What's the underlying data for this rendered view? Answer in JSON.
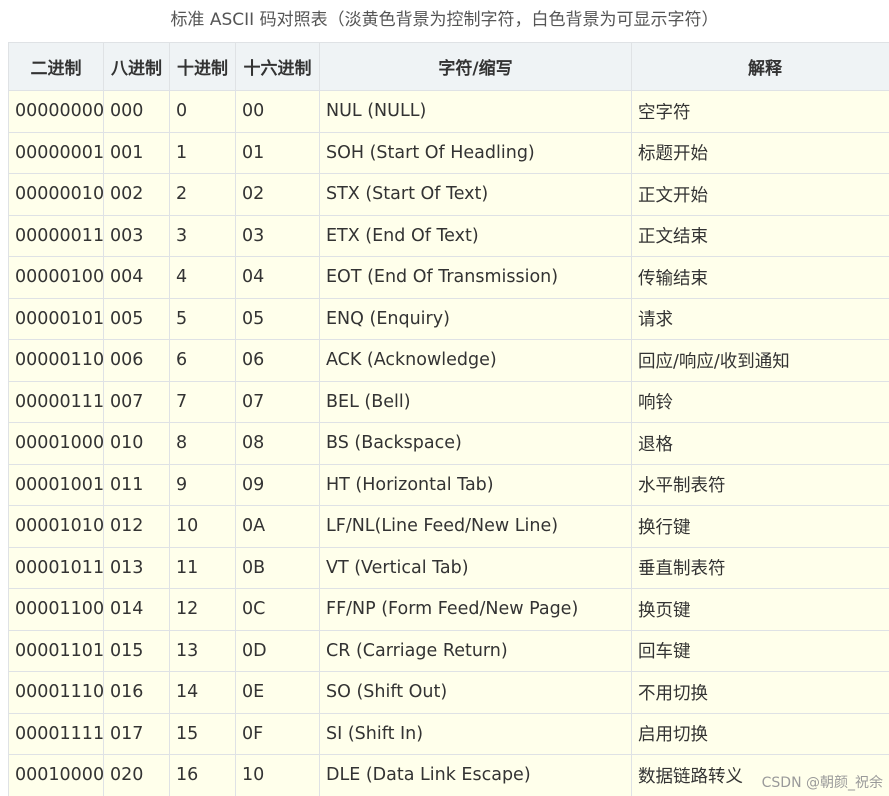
{
  "caption": "标准 ASCII 码对照表（淡黄色背景为控制字符，白色背景为可显示字符）",
  "colors": {
    "header_bg": "#eff3f5",
    "control_char_bg": "#ffffeb",
    "border": "#dfe2e5"
  },
  "table": {
    "headers": [
      "二进制",
      "八进制",
      "十进制",
      "十六进制",
      "字符/缩写",
      "解释"
    ],
    "rows": [
      [
        "00000000",
        "000",
        "0",
        "00",
        "NUL (NULL)",
        "空字符"
      ],
      [
        "00000001",
        "001",
        "1",
        "01",
        "SOH (Start Of Headling)",
        "标题开始"
      ],
      [
        "00000010",
        "002",
        "2",
        "02",
        "STX (Start Of Text)",
        "正文开始"
      ],
      [
        "00000011",
        "003",
        "3",
        "03",
        "ETX (End Of Text)",
        "正文结束"
      ],
      [
        "00000100",
        "004",
        "4",
        "04",
        "EOT (End Of Transmission)",
        "传输结束"
      ],
      [
        "00000101",
        "005",
        "5",
        "05",
        "ENQ (Enquiry)",
        "请求"
      ],
      [
        "00000110",
        "006",
        "6",
        "06",
        "ACK (Acknowledge)",
        "回应/响应/收到通知"
      ],
      [
        "00000111",
        "007",
        "7",
        "07",
        "BEL (Bell)",
        "响铃"
      ],
      [
        "00001000",
        "010",
        "8",
        "08",
        "BS (Backspace)",
        "退格"
      ],
      [
        "00001001",
        "011",
        "9",
        "09",
        "HT (Horizontal Tab)",
        "水平制表符"
      ],
      [
        "00001010",
        "012",
        "10",
        "0A",
        "LF/NL(Line Feed/New Line)",
        "换行键"
      ],
      [
        "00001011",
        "013",
        "11",
        "0B",
        "VT (Vertical Tab)",
        "垂直制表符"
      ],
      [
        "00001100",
        "014",
        "12",
        "0C",
        "FF/NP (Form Feed/New Page)",
        "换页键"
      ],
      [
        "00001101",
        "015",
        "13",
        "0D",
        "CR (Carriage Return)",
        "回车键"
      ],
      [
        "00001110",
        "016",
        "14",
        "0E",
        "SO (Shift Out)",
        "不用切换"
      ],
      [
        "00001111",
        "017",
        "15",
        "0F",
        "SI (Shift In)",
        "启用切换"
      ],
      [
        "00010000",
        "020",
        "16",
        "10",
        "DLE (Data Link Escape)",
        "数据链路转义"
      ]
    ]
  },
  "watermark": "CSDN @朝颜_祝余"
}
